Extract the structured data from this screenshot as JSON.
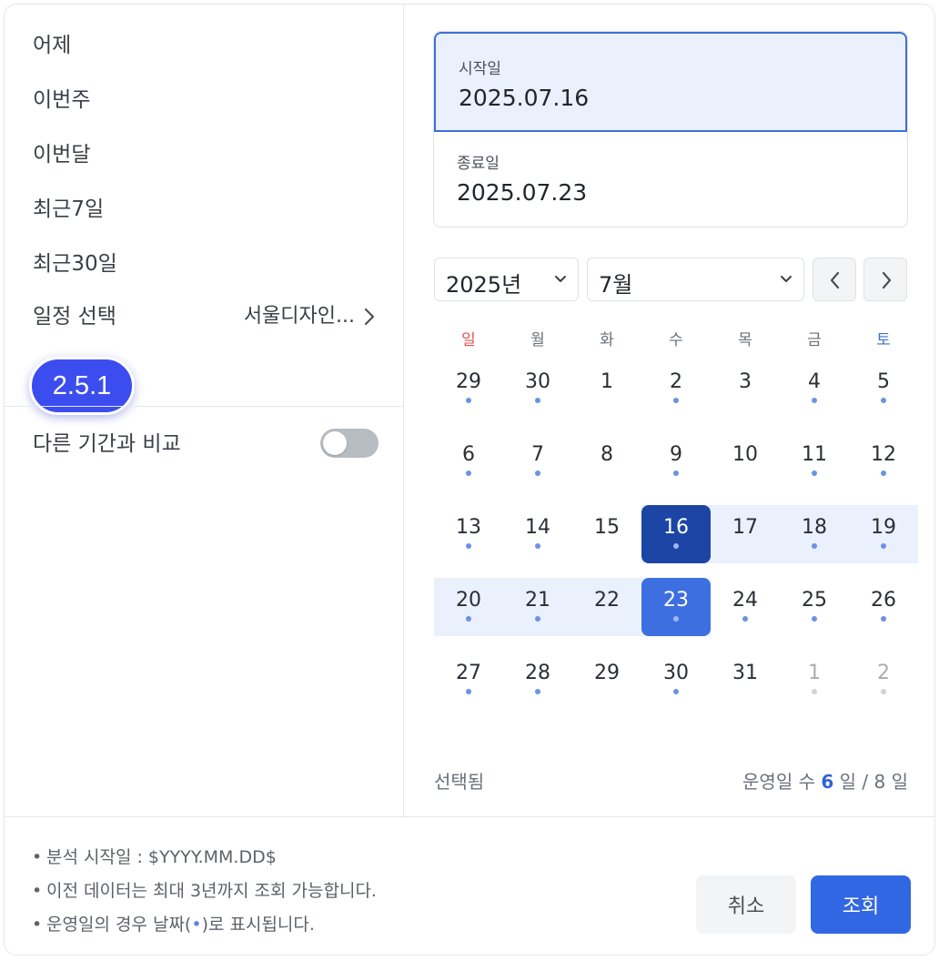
{
  "presets": [
    "어제",
    "이번주",
    "이번달",
    "최근7일",
    "최근30일"
  ],
  "schedule": {
    "label": "일정 선택",
    "value": "서울디자인..."
  },
  "version_badge": "2.5.1",
  "compare": {
    "label": "다른 기간과 비교",
    "enabled": false
  },
  "start": {
    "caption": "시작일",
    "value": "2025.07.16"
  },
  "end": {
    "caption": "종료일",
    "value": "2025.07.23"
  },
  "year_select": "2025년",
  "month_select": "7월",
  "weekdays": [
    "일",
    "월",
    "화",
    "수",
    "목",
    "금",
    "토"
  ],
  "colors": {
    "sunday": "#e0524f",
    "saturday": "#3f72c8",
    "accent": "#3167e3",
    "range": "#eaf0fc"
  },
  "weeks": [
    [
      {
        "d": "29",
        "dot": true
      },
      {
        "d": "30",
        "dot": true
      },
      {
        "d": "1",
        "dot": false
      },
      {
        "d": "2",
        "dot": true
      },
      {
        "d": "3",
        "dot": false
      },
      {
        "d": "4",
        "dot": true
      },
      {
        "d": "5",
        "dot": true
      }
    ],
    [
      {
        "d": "6",
        "dot": true
      },
      {
        "d": "7",
        "dot": true
      },
      {
        "d": "8",
        "dot": false
      },
      {
        "d": "9",
        "dot": true
      },
      {
        "d": "10",
        "dot": false
      },
      {
        "d": "11",
        "dot": true
      },
      {
        "d": "12",
        "dot": true
      }
    ],
    [
      {
        "d": "13",
        "dot": true
      },
      {
        "d": "14",
        "dot": true
      },
      {
        "d": "15",
        "dot": false
      },
      {
        "d": "16",
        "dot": true,
        "state": "start"
      },
      {
        "d": "17",
        "dot": false,
        "state": "range"
      },
      {
        "d": "18",
        "dot": true,
        "state": "range"
      },
      {
        "d": "19",
        "dot": true,
        "state": "range"
      }
    ],
    [
      {
        "d": "20",
        "dot": true,
        "state": "range"
      },
      {
        "d": "21",
        "dot": true,
        "state": "range"
      },
      {
        "d": "22",
        "dot": false,
        "state": "range"
      },
      {
        "d": "23",
        "dot": true,
        "state": "end"
      },
      {
        "d": "24",
        "dot": true
      },
      {
        "d": "25",
        "dot": true
      },
      {
        "d": "26",
        "dot": true
      }
    ],
    [
      {
        "d": "27",
        "dot": true
      },
      {
        "d": "28",
        "dot": true
      },
      {
        "d": "29",
        "dot": false
      },
      {
        "d": "30",
        "dot": true
      },
      {
        "d": "31",
        "dot": false
      },
      {
        "d": "1",
        "dot": true,
        "muted": true
      },
      {
        "d": "2",
        "dot": true,
        "muted": true
      }
    ]
  ],
  "summary": {
    "selected_label": "선택됨",
    "op_prefix": "운영일 수",
    "op_count": "6",
    "op_mid": "일 /",
    "op_total": "8",
    "op_suffix": "일"
  },
  "notes": [
    {
      "before": "분석 시작일 : $YYYY.MM.DD$",
      "dot": "",
      "after": ""
    },
    {
      "before": "이전 데이터는 최대 3년까지 조회 가능합니다.",
      "dot": "",
      "after": ""
    },
    {
      "before": "운영일의 경우 날짜(",
      "dot": "•",
      "after": ")로 표시됩니다."
    }
  ],
  "buttons": {
    "cancel": "취소",
    "query": "조회"
  }
}
